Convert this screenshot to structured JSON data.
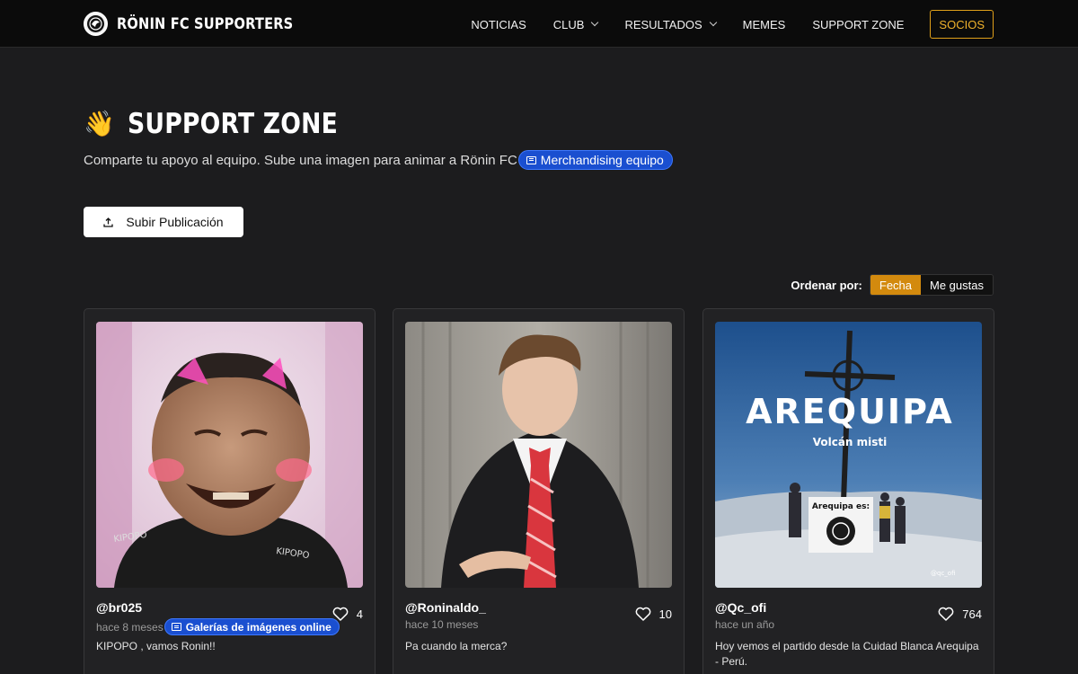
{
  "brand": {
    "name": "RÖNIN FC SUPPORTERS",
    "logo_icon": "club-crest-icon"
  },
  "nav": {
    "items": [
      {
        "label": "NOTICIAS",
        "dropdown": false
      },
      {
        "label": "CLUB",
        "dropdown": true
      },
      {
        "label": "RESULTADOS",
        "dropdown": true
      },
      {
        "label": "MEMES",
        "dropdown": false
      },
      {
        "label": "SUPPORT ZONE",
        "dropdown": false
      }
    ],
    "cta_label": "SOCIOS"
  },
  "header": {
    "icon": "waving-hand-emoji",
    "title": "SUPPORT ZONE",
    "subtitle": "Comparte tu apoyo al equipo. Sube una imagen para animar a Rönin FC",
    "chip_label": "Merchandising equipo"
  },
  "upload_button": {
    "label": "Subir Publicación",
    "icon": "upload-icon"
  },
  "sort": {
    "label": "Ordenar por:",
    "options": [
      "Fecha",
      "Me gustas"
    ],
    "active": "Fecha"
  },
  "posts": [
    {
      "user": "@br025",
      "time": "hace 8 meses",
      "likes": "4",
      "text": "KIPOPO , vamos Ronin!!",
      "chip": "Galerías de imágenes online",
      "image": "baby-face-meme"
    },
    {
      "user": "@Roninaldo_",
      "time": "hace 10 meses",
      "likes": "10",
      "text": "Pa cuando la merca?",
      "image": "man-in-suit-pointing"
    },
    {
      "user": "@Qc_ofi",
      "time": "hace un año",
      "likes": "764",
      "text": "Hoy vemos el partido desde la Cuidad Blanca Arequipa - Perú.",
      "image": "volcano-summit-cross",
      "image_text": {
        "headline": "AREQUIPA",
        "sub": "Volcán misti",
        "sign": "Arequipa es:",
        "watermark": "@qc_ofi"
      }
    }
  ],
  "colors": {
    "accent": "#d38a0e",
    "chip_blue": "#1a4fd0",
    "background": "#1c1c1e",
    "navbar": "#0b0b0b"
  }
}
